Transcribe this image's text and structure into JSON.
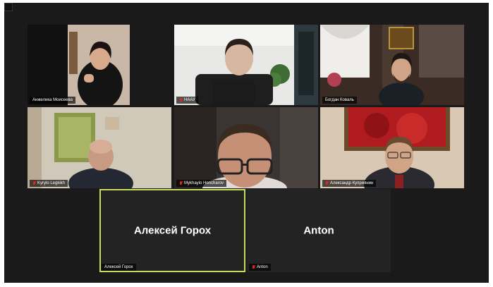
{
  "participants": [
    {
      "name": "Анжелика Моисеева",
      "muted": false,
      "video": true
    },
    {
      "name": "НААУ",
      "muted": true,
      "video": true
    },
    {
      "name": "Богдан Коваль",
      "muted": false,
      "video": true
    },
    {
      "name": "Kyrylo Legkikh",
      "muted": true,
      "video": true
    },
    {
      "name": "Mykhaylo Honcharov",
      "muted": true,
      "video": true
    },
    {
      "name": "Александр Куприянин",
      "muted": true,
      "video": true
    },
    {
      "name": "Алексей Горох",
      "display_name": "Алексей Горох",
      "muted": false,
      "video": false,
      "active_speaker": true
    },
    {
      "name": "Anton",
      "display_name": "Anton",
      "muted": true,
      "video": false
    }
  ],
  "colors": {
    "background": "#1a1a1a",
    "tile_off": "#232323",
    "active_outline": "#c6dd5b",
    "mute_icon": "#e0252b"
  },
  "icons": [
    "mic-muted-icon",
    "window-menu-icon"
  ]
}
